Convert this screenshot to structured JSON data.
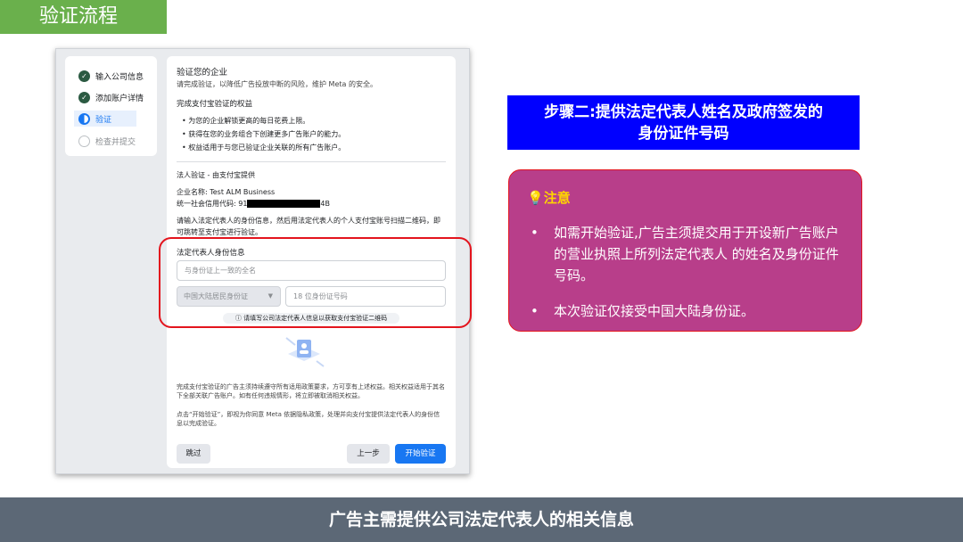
{
  "slide_title": "验证流程",
  "steps": [
    {
      "label": "输入公司信息",
      "state": "done"
    },
    {
      "label": "添加账户详情",
      "state": "done"
    },
    {
      "label": "验证",
      "state": "current"
    },
    {
      "label": "检查并提交",
      "state": "pending"
    }
  ],
  "card": {
    "heading": "验证您的企业",
    "subheading": "请完成验证，以降低广告投放中断的风险，维护 Meta 的安全。",
    "benefits_title": "完成支付宝验证的权益",
    "benefits": [
      "为您的企业解锁更高的每日花费上限。",
      "获得在您的业务组合下创建更多广告账户的能力。",
      "权益适用于与您已验证企业关联的所有广告账户。"
    ],
    "legal_title": "法人验证 - 由支付宝提供",
    "company_label": "企业名称: Test ALM Business",
    "credit_code_prefix": "统一社会信用代码: 91",
    "credit_code_suffix": "4B",
    "instructions": "请输入法定代表人的身份信息，然后用法定代表人的个人支付宝账号扫描二维码，即可跳转至支付宝进行验证。",
    "id_section_title": "法定代表人身份信息",
    "name_placeholder": "与身份证上一致的全名",
    "id_type": "中国大陆居民身份证",
    "id_placeholder": "18 位身份证号码",
    "hint": "请填写公司法定代表人信息以获取支付宝验证二维码",
    "footer1": "完成支付宝验证的广告主须持续遵守所有适用政策要求，方可享有上述权益。相关权益适用于其名下全部关联广告账户。如有任何违规情形，将立即被取消相关权益。",
    "footer2": "点击“开始验证”，即视为你同意 Meta 依据隐私政策，处理并向支付宝提供法定代表人的身份信息以完成验证。",
    "skip_label": "跳过",
    "back_label": "上一步",
    "start_label": "开始验证"
  },
  "step2_title_line1": "步骤二:提供法定代表人姓名及政府签发的",
  "step2_title_line2": "身份证件号码",
  "note": {
    "title": "注意",
    "icon": "lightbulb-icon",
    "bullets": [
      "如需开始验证,广告主须提交用于开设新广告账户的营业执照上所列法定代表人 的姓名及身份证件号码。",
      "本次验证仅接受中国大陆身份证。"
    ]
  },
  "bottom_banner": "广告主需提供公司法定代表人的相关信息",
  "colors": {
    "green": "#6ab04c",
    "blue_box": "#0000ff",
    "note_bg": "#b83e8a",
    "banner": "#5c6876",
    "meta_blue": "#1877f2"
  }
}
